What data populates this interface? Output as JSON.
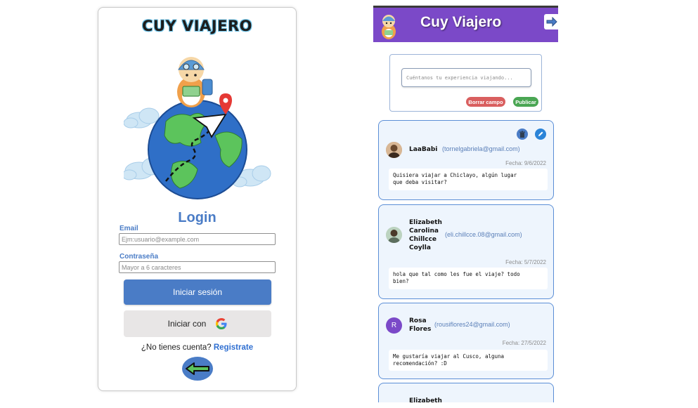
{
  "login": {
    "brand": "CUY VIAJERO",
    "title": "Login",
    "email_label": "Email",
    "email_placeholder": "Ejm:usuario@example.com",
    "password_label": "Contraseña",
    "password_placeholder": "Mayor a 6 caracteres",
    "login_button": "Iniciar sesión",
    "google_button": "Iniciar con",
    "no_account": "¿No tienes cuenta?",
    "register_link": "Registrate",
    "icons": [
      "guinea-pig-traveler-icon",
      "globe-icon",
      "google-icon",
      "back-arrow-icon"
    ]
  },
  "feed": {
    "title": "Cuy Viajero",
    "composer_placeholder": "Cuéntanos tu experiencia viajando...",
    "clear_button": "Borrar campo",
    "publish_button": "Publicar",
    "posts": [
      {
        "name": "LaaBabi",
        "email": "(tornelgabriela@gmail.com)",
        "date": "Fecha: 9/6/2022",
        "body": "Quisiera viajar a Chiclayo, algún lugar\nque deba visitar?"
      },
      {
        "name": "Elizabeth\nCarolina\nChillcce\nCoylla",
        "email": "(eli.chillcce.08@gmail.com)",
        "date": "Fecha: 5/7/2022",
        "body": "hola que tal como les fue el viaje? todo\nbien?"
      },
      {
        "name": "Rosa\nFlores",
        "avatar_letter": "R",
        "email": "(rousiflores24@gmail.com)",
        "date": "Fecha: 27/5/2022",
        "body": "Me gustaría viajar al Cusco, alguna\nrecomendación?  :D"
      },
      {
        "name": "Elizabeth"
      }
    ]
  },
  "colors": {
    "primary_blue": "#4a7cc6",
    "header_purple": "#7b49c8",
    "clear_red": "#d95f5f",
    "publish_green": "#4aa653",
    "post_bg": "#eef5fd"
  }
}
